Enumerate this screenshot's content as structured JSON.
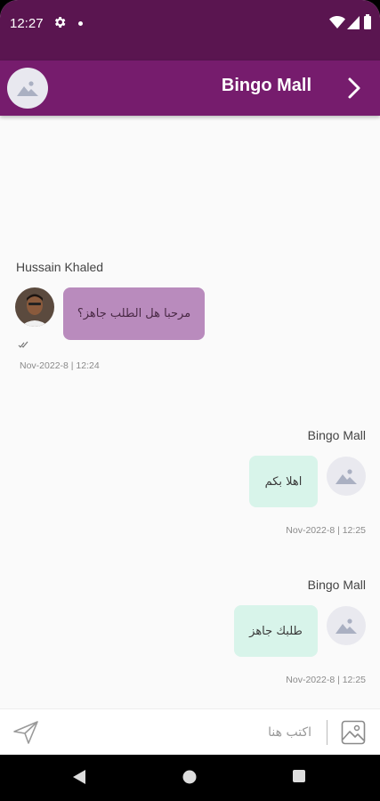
{
  "status_bar": {
    "time": "12:27"
  },
  "header": {
    "title": "Bingo Mall"
  },
  "messages": [
    {
      "sender": "Hussain Khaled",
      "text": "مرحبا هل الطلب جاهز؟",
      "time": "Nov-2022-8 | 12:24",
      "direction": "incoming"
    },
    {
      "sender": "Bingo Mall",
      "text": "اهلا بكم",
      "time": "Nov-2022-8 | 12:25",
      "direction": "outgoing"
    },
    {
      "sender": "Bingo Mall",
      "text": "طلبك جاهز",
      "time": "Nov-2022-8 | 12:25",
      "direction": "outgoing"
    }
  ],
  "composer": {
    "placeholder": "اكتب هنا"
  },
  "colors": {
    "status_bar": "#5a1550",
    "app_bar": "#761c6d",
    "incoming_bubble": "#b98bbd",
    "outgoing_bubble": "#d8f4ea"
  },
  "icons": {
    "send": "send-icon",
    "gallery": "image-icon",
    "forward": "chevron-right-icon",
    "read": "double-check-icon"
  }
}
